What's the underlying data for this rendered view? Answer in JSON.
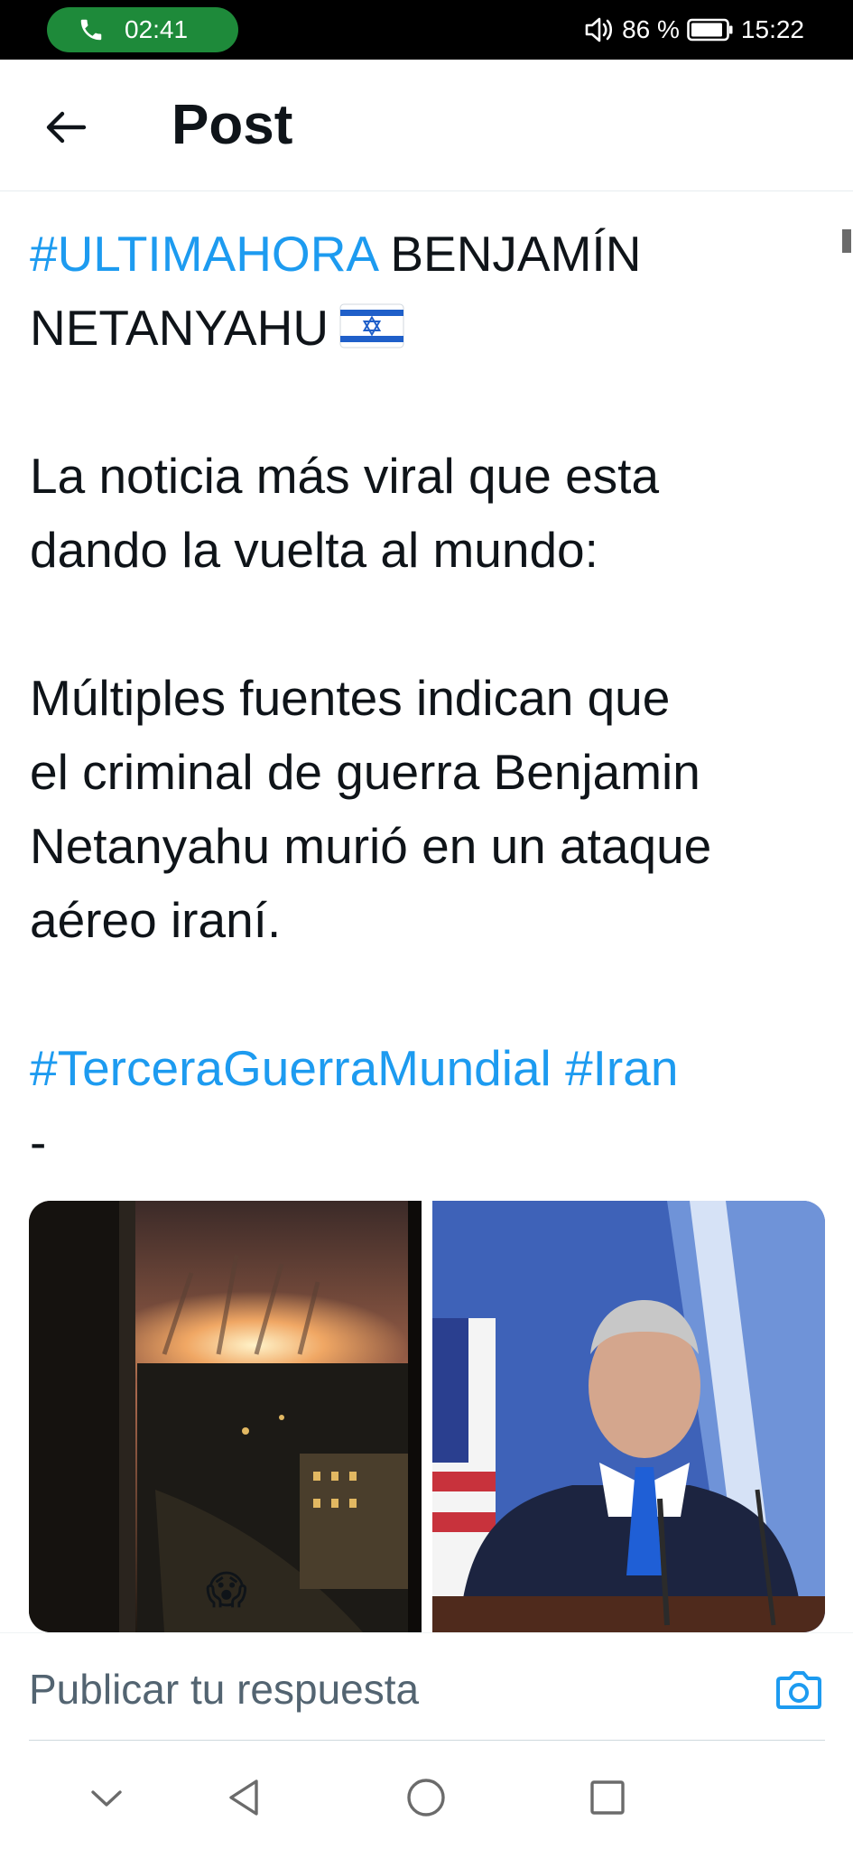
{
  "status_bar": {
    "call_time": "02:41",
    "battery_percent": "86 %",
    "clock": "15:22",
    "icons": [
      "phone-icon",
      "volume-icon",
      "battery-icon"
    ]
  },
  "header": {
    "title": "Post",
    "back_icon": "arrow-left-icon"
  },
  "post": {
    "headline_hashtag": "#ULTIMAHORA",
    "headline_rest": "BENJAMÍN",
    "headline_line2": "NETANYAHU",
    "flag": "israel-flag-icon",
    "para1_line1": "La noticia más viral que esta",
    "para1_line2": "dando la vuelta al mundo:",
    "para2_line1": "Múltiples fuentes indican que",
    "para2_line2": "el criminal de guerra Benjamin",
    "para2_line3": "Netanyahu murió en un ataque",
    "para2_line4": "aéreo iraní.",
    "hashtag_1": "#TerceraGuerraMundial",
    "hashtag_2": "#Iran",
    "trailing": "-",
    "media": [
      {
        "alt": "night-city-explosion-photo",
        "emoji": "😱"
      },
      {
        "alt": "netanyahu-speaking-photo"
      }
    ]
  },
  "reply": {
    "placeholder": "Publicar tu respuesta",
    "camera_icon": "camera-icon"
  },
  "navbar": {
    "icons": [
      "chevron-down-icon",
      "back-triangle-icon",
      "home-circle-icon",
      "recents-square-icon"
    ]
  },
  "colors": {
    "accent": "#1d9bf0",
    "text": "#0f1419",
    "muted": "#536471",
    "call_pill": "#1e8a3a"
  }
}
